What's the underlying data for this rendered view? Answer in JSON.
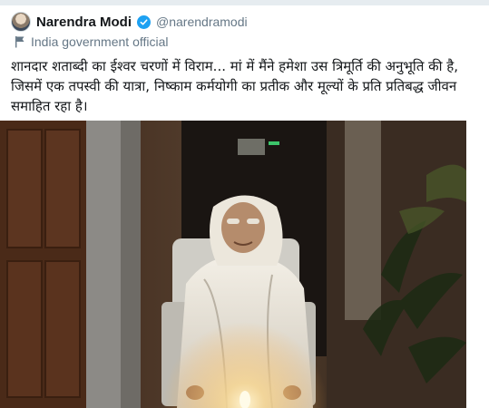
{
  "user": {
    "name": "Narendra Modi",
    "handle": "@narendramodi",
    "label": "India government official",
    "icons": {
      "avatar": "avatar",
      "verified": "verified-badge-icon",
      "flag": "flag-icon"
    }
  },
  "tweet": {
    "text": "शानदार शताब्दी का ईश्वर चरणों में विराम... मां में मैंने हमेशा उस त्रिमूर्ति की अनुभूति की है, जिसमें एक तपस्वी की यात्रा, निष्काम कर्मयोगी का प्रतीक और मूल्यों के प्रति प्रतिबद्ध जीवन समाहित रहा है।"
  },
  "colors": {
    "verified": "#1da1f2",
    "muted": "#657786",
    "text": "#14171a"
  }
}
